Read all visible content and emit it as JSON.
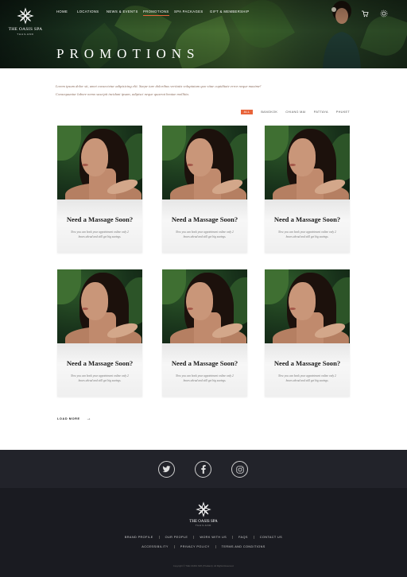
{
  "brand": {
    "name": "THE OASIS SPA",
    "tagline": "THAILAND"
  },
  "nav": {
    "items": [
      {
        "label": "HOME"
      },
      {
        "label": "LOCATIONS"
      },
      {
        "label": "NEWS & EVENTS"
      },
      {
        "label": "PROMOTIONS",
        "active": true
      },
      {
        "label": "SPA PACKAGES"
      },
      {
        "label": "GIFT & MEMBERSHIP"
      }
    ]
  },
  "hero": {
    "title": "PROMOTIONS"
  },
  "intro": {
    "line1": "Lorem ipsum dolor sit, amet consectetur adipisicing elit. Saepe iure doloribus veritatis voluptatum quo vitae cupiditate error neque maxime!",
    "line2": "Consequuntur labore nemo suscipit incidunt ipsam, adipisci neque quaerat beatae mollitia."
  },
  "filters": [
    "ALL",
    "BANGKOK",
    "CHIANG MAI",
    "PATTAYA",
    "PHUKET"
  ],
  "cards": [
    {
      "title": "Need a Massage Soon?",
      "body": "Now you can book your appointment online only 2 hours ahead and still get big savings."
    },
    {
      "title": "Need a Massage Soon?",
      "body": "Now you can book your appointment online only 2 hours ahead and still get big savings."
    },
    {
      "title": "Need a Massage Soon?",
      "body": "Now you can book your appointment online only 2 hours ahead and still get big savings."
    },
    {
      "title": "Need a Massage Soon?",
      "body": "Now you can book your appointment online only 2 hours ahead and still get big savings."
    },
    {
      "title": "Need a Massage Soon?",
      "body": "Now you can book your appointment online only 2 hours ahead and still get big savings."
    },
    {
      "title": "Need a Massage Soon?",
      "body": "Now you can book your appointment online only 2 hours ahead and still get big savings."
    }
  ],
  "load_more": "LOAD MORE",
  "social": [
    "twitter-icon",
    "facebook-icon",
    "instagram-icon"
  ],
  "footer": {
    "links_row1": [
      "BRAND PROFILE",
      "OUR PEOPLE",
      "WORK WITH US",
      "FAQS",
      "CONTACT US"
    ],
    "links_row2": [
      "ACCESSIBILITY",
      "PRIVACY POLICY",
      "TERMS AND CONDITIONS"
    ],
    "copyright": "Copyright © THE OASIS SPA (Thailand). All Rights Reserved."
  },
  "colors": {
    "accent": "#e8643a",
    "footer_dark": "#1a1b21",
    "intro_text": "#8b6c5c"
  }
}
